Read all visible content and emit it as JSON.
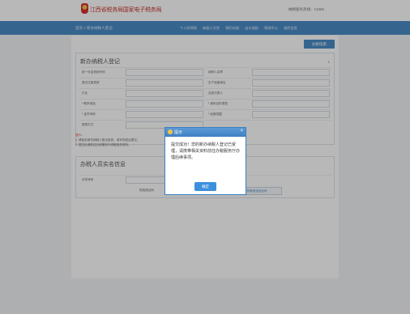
{
  "header": {
    "site_title": "江西省税务局国家电子税务局",
    "hotline": "纳税服务热线：12366"
  },
  "navbar": {
    "current": "首页 > 新办纳税人登记",
    "links": [
      "个人所得税",
      "纳税人学堂",
      "预约办税",
      "出口退税",
      "帮助中心",
      "我的信息"
    ]
  },
  "top_button": "办税指南",
  "panel": {
    "title": "新办纳税人登记",
    "collapse": "∧",
    "rows": [
      {
        "l_label": "统一社会信用代码",
        "l_value": "",
        "r_label": "纳税人名称",
        "r_value": ""
      },
      {
        "l_label": "登记注册类型",
        "l_value": "",
        "r_label": "生产经营地址",
        "r_value": ""
      },
      {
        "l_label": "行业",
        "l_value": "",
        "r_label": "法定代表人",
        "r_value": ""
      },
      {
        "l_label": "* 联系电话",
        "l_value": "",
        "r_label": "* 身份证件类型",
        "r_value": ""
      },
      {
        "l_label": "* 证件号码",
        "l_value": "",
        "r_label": "* 经营范围",
        "r_value": ""
      },
      {
        "l_label": "核算方式",
        "l_value": "",
        "r_label": "",
        "r_value": ""
      }
    ]
  },
  "notes": {
    "warning": "提示：",
    "line1": "1. 请如实填写纳税人登记信息，填写完成后提交。",
    "line2": "2. 提交后请前往办税服务厅领取相关资料。"
  },
  "panel2": {
    "title": "办税人员实名信息",
    "mobile_label": "手机号码",
    "mobile_value": "",
    "code_label": "短信验证码",
    "send_code": "获取短信验证码"
  },
  "dialog": {
    "title": "提示",
    "close": "×",
    "message": "提交成功！您的新办纳税人登记已受理，请携带相关资料前往办税服务厅办理后续事项。",
    "ok_label": "确定"
  }
}
